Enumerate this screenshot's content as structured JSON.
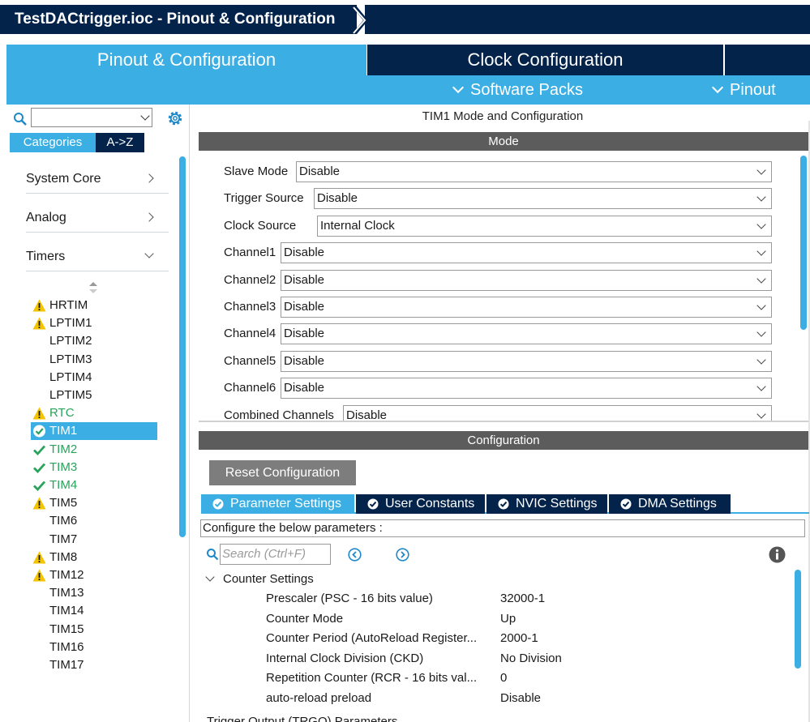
{
  "window": {
    "title": "TestDACtrigger.ioc - Pinout & Configuration"
  },
  "main_tabs": [
    {
      "label": "Pinout & Configuration",
      "active": true
    },
    {
      "label": "Clock Configuration",
      "active": false
    }
  ],
  "subbar": {
    "software_packs": "Software Packs",
    "pinout": "Pinout"
  },
  "left_panel": {
    "search": {
      "value": ""
    },
    "tabs": {
      "categories": "Categories",
      "az": "A->Z"
    },
    "groups": [
      {
        "label": "System Core",
        "expanded": false
      },
      {
        "label": "Analog",
        "expanded": false
      },
      {
        "label": "Timers",
        "expanded": true
      }
    ],
    "timers": [
      {
        "label": "HRTIM",
        "status": "warning"
      },
      {
        "label": "LPTIM1",
        "status": "warning"
      },
      {
        "label": "LPTIM2",
        "status": "none"
      },
      {
        "label": "LPTIM3",
        "status": "none"
      },
      {
        "label": "LPTIM4",
        "status": "none"
      },
      {
        "label": "LPTIM5",
        "status": "none"
      },
      {
        "label": "RTC",
        "status": "warning"
      },
      {
        "label": "TIM1",
        "status": "selected"
      },
      {
        "label": "TIM2",
        "status": "ok"
      },
      {
        "label": "TIM3",
        "status": "ok"
      },
      {
        "label": "TIM4",
        "status": "ok"
      },
      {
        "label": "TIM5",
        "status": "warning"
      },
      {
        "label": "TIM6",
        "status": "none"
      },
      {
        "label": "TIM7",
        "status": "none"
      },
      {
        "label": "TIM8",
        "status": "warning"
      },
      {
        "label": "TIM12",
        "status": "warning"
      },
      {
        "label": "TIM13",
        "status": "none"
      },
      {
        "label": "TIM14",
        "status": "none"
      },
      {
        "label": "TIM15",
        "status": "none"
      },
      {
        "label": "TIM16",
        "status": "none"
      },
      {
        "label": "TIM17",
        "status": "none"
      }
    ]
  },
  "mode_panel": {
    "title": "TIM1 Mode and Configuration",
    "header": "Mode",
    "rows": [
      {
        "label": "Slave Mode",
        "value": "Disable"
      },
      {
        "label": "Trigger Source",
        "value": "Disable"
      },
      {
        "label": "Clock Source",
        "value": "Internal Clock"
      },
      {
        "label": "Channel1",
        "value": "Disable"
      },
      {
        "label": "Channel2",
        "value": "Disable"
      },
      {
        "label": "Channel3",
        "value": "Disable"
      },
      {
        "label": "Channel4",
        "value": "Disable"
      },
      {
        "label": "Channel5",
        "value": "Disable"
      },
      {
        "label": "Channel6",
        "value": "Disable"
      },
      {
        "label": "Combined Channels",
        "value": "Disable"
      }
    ]
  },
  "config_panel": {
    "header": "Configuration",
    "reset_label": "Reset Configuration",
    "tabs": [
      {
        "label": "Parameter Settings",
        "active": true
      },
      {
        "label": "User Constants",
        "active": false
      },
      {
        "label": "NVIC Settings",
        "active": false
      },
      {
        "label": "DMA Settings",
        "active": false
      }
    ],
    "configure_text": "Configure the below parameters :",
    "search_placeholder": "Search (Ctrl+F)",
    "group_label": "Counter Settings",
    "params": [
      {
        "name": "Prescaler (PSC - 16 bits value)",
        "value": "32000-1"
      },
      {
        "name": "Counter Mode",
        "value": "Up"
      },
      {
        "name": "Counter Period (AutoReload Register...",
        "value": "2000-1"
      },
      {
        "name": "Internal Clock Division (CKD)",
        "value": "No Division"
      },
      {
        "name": "Repetition Counter (RCR - 16 bits val...",
        "value": "0"
      },
      {
        "name": "auto-reload preload",
        "value": "Disable"
      }
    ],
    "next_group_label": "Trigger Output (TRGO) Parameters"
  },
  "colors": {
    "navy": "#03234b",
    "accent_blue": "#3baee4",
    "ok_green": "#27a35a",
    "warning_yellow": "#f5c400",
    "header_gray": "#5c5c5c"
  }
}
